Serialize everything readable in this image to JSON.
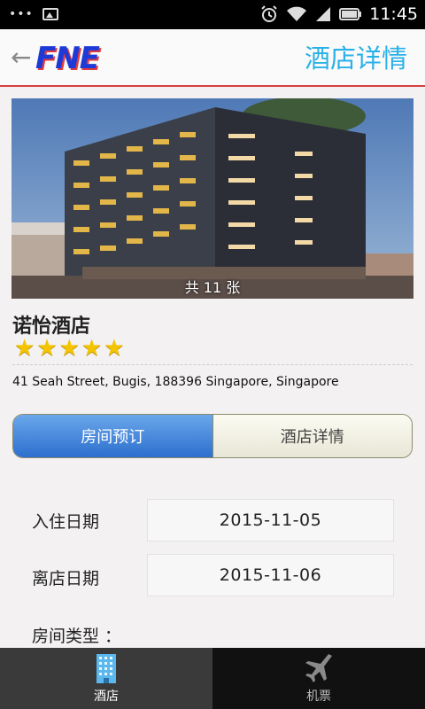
{
  "status_bar": {
    "time": "11:45",
    "left_icons": [
      "more-dots-icon",
      "image-notification-icon"
    ],
    "right_icons": [
      "alarm-icon",
      "wifi-icon",
      "signal-icon",
      "battery-icon"
    ]
  },
  "header": {
    "logo_text": "FNE",
    "title": "酒店详情",
    "back_icon": "back-arrow-icon"
  },
  "photo": {
    "caption": "共 11 张"
  },
  "hotel": {
    "name": "诺怡酒店",
    "stars": 5,
    "address": "41 Seah Street, Bugis, 188396 Singapore, Singapore"
  },
  "tabs": [
    {
      "label": "房间预订",
      "active": true
    },
    {
      "label": "酒店详情",
      "active": false
    }
  ],
  "form": {
    "checkin_label": "入住日期",
    "checkin_value": "2015-11-05",
    "checkout_label": "离店日期",
    "checkout_value": "2015-11-06",
    "room_type_label": "房间类型 ："
  },
  "bottom_nav": [
    {
      "label": "酒店",
      "icon": "building-icon",
      "active": true
    },
    {
      "label": "机票",
      "icon": "airplane-icon",
      "active": false
    }
  ],
  "colors": {
    "header_title": "#2ab0e8",
    "header_border": "#d64040",
    "tab_active": "#3b7fdc",
    "star": "#f5c400"
  }
}
